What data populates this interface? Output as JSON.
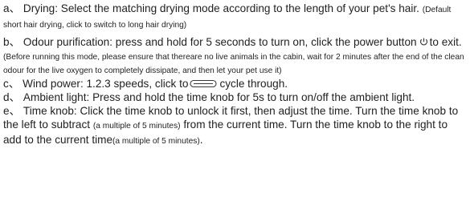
{
  "items": {
    "a": {
      "lead": "a、 Drying: Select the matching drying mode according to the length of your pet's hair.",
      "note": "(Default short hair drying, click to switch to long hair drying)"
    },
    "b": {
      "lead": "b、 Odour purification: press and hold for 5 seconds to turn on, click the power button",
      "after_icon": "to exit.",
      "note": "(Before running this mode, please ensure that thereare no live animals in the cabin, wait for 2 minutes after the end of the clean odour for the live oxygen to completely dissipate, and then let your pet use it)",
      "icon": "power-icon"
    },
    "c": {
      "lead": "c、 Wind power: 1.2.3 speeds, click to",
      "after_icon": "cycle through.",
      "icon": "wind-icon"
    },
    "d": {
      "text": "d、 Ambient light: Press and hold the time knob for 5s to turn on/off the ambient light."
    },
    "e": {
      "text1": "e、 Time knob: Click the time knob to unlock it first, then adjust the time. Turn the time knob to the left to subtract",
      "note1": "(a multiple of 5 minutes)",
      "text2": "from the current time. Turn the time knob to the right to add to the current time",
      "note2": "(a multiple of 5 minutes)",
      "end": "."
    }
  },
  "colors": {
    "text": "#1f1f1f",
    "icon": "#3a3a3a"
  }
}
